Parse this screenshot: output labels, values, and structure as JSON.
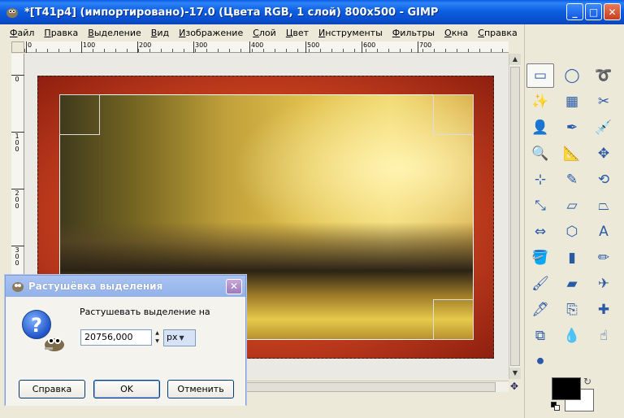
{
  "window": {
    "title": "*[T41p4] (импортировано)-17.0 (Цвета RGB, 1 слой) 800x500 - GIMP",
    "minimize": "_",
    "maximize": "□",
    "close": "✕"
  },
  "menu": [
    "Файл",
    "Правка",
    "Выделение",
    "Вид",
    "Изображение",
    "Слой",
    "Цвет",
    "Инструменты",
    "Фильтры",
    "Окна",
    "Справка"
  ],
  "ruler": {
    "h_labels": [
      "0",
      "100",
      "200",
      "300",
      "400",
      "500",
      "600",
      "700"
    ],
    "v_labels": [
      "0",
      "100",
      "200",
      "300"
    ]
  },
  "toolbox": {
    "tools": [
      {
        "name": "rect-select",
        "glyph": "▭"
      },
      {
        "name": "ellipse-select",
        "glyph": "◯"
      },
      {
        "name": "free-select",
        "glyph": "➰"
      },
      {
        "name": "fuzzy-select",
        "glyph": "✨"
      },
      {
        "name": "color-select",
        "glyph": "▦"
      },
      {
        "name": "scissors",
        "glyph": "✂"
      },
      {
        "name": "foreground-select",
        "glyph": "👤"
      },
      {
        "name": "paths",
        "glyph": "✒"
      },
      {
        "name": "color-picker",
        "glyph": "💉"
      },
      {
        "name": "zoom",
        "glyph": "🔍"
      },
      {
        "name": "measure",
        "glyph": "📐"
      },
      {
        "name": "move",
        "glyph": "✥"
      },
      {
        "name": "align",
        "glyph": "⊹"
      },
      {
        "name": "crop",
        "glyph": "✎"
      },
      {
        "name": "rotate",
        "glyph": "⟲"
      },
      {
        "name": "scale",
        "glyph": "⤡"
      },
      {
        "name": "shear",
        "glyph": "▱"
      },
      {
        "name": "perspective",
        "glyph": "⏢"
      },
      {
        "name": "flip",
        "glyph": "⇔"
      },
      {
        "name": "cage-transform",
        "glyph": "⬡"
      },
      {
        "name": "text",
        "glyph": "A"
      },
      {
        "name": "bucket-fill",
        "glyph": "🪣"
      },
      {
        "name": "blend",
        "glyph": "▮"
      },
      {
        "name": "pencil",
        "glyph": "✏"
      },
      {
        "name": "paintbrush",
        "glyph": "🖌"
      },
      {
        "name": "eraser",
        "glyph": "▰"
      },
      {
        "name": "airbrush",
        "glyph": "✈"
      },
      {
        "name": "ink",
        "glyph": "🖋"
      },
      {
        "name": "clone",
        "glyph": "⎘"
      },
      {
        "name": "heal",
        "glyph": "✚"
      },
      {
        "name": "perspective-clone",
        "glyph": "⧉"
      },
      {
        "name": "blur",
        "glyph": "💧"
      },
      {
        "name": "smudge",
        "glyph": "☝"
      },
      {
        "name": "dodge-burn",
        "glyph": "⚫"
      }
    ],
    "colors": {
      "foreground": "#000000",
      "background": "#ffffff"
    }
  },
  "dialog": {
    "title": "Растушёвка выделения",
    "close": "✕",
    "label": "Растушевать выделение на",
    "value": "20756,000",
    "unit": "px",
    "buttons": {
      "help": "Справка",
      "ok": "OK",
      "cancel": "Отменить"
    }
  }
}
